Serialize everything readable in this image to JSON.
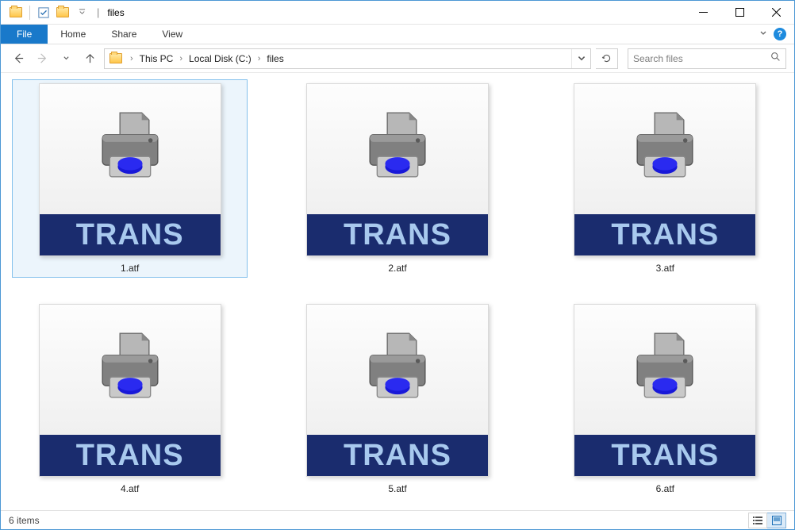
{
  "window": {
    "title": "files"
  },
  "tabs": {
    "file": "File",
    "home": "Home",
    "share": "Share",
    "view": "View"
  },
  "breadcrumbs": [
    "This PC",
    "Local Disk (C:)",
    "files"
  ],
  "search": {
    "placeholder": "Search files"
  },
  "files": [
    {
      "name": "1.atf",
      "badge": "TRANS",
      "selected": true
    },
    {
      "name": "2.atf",
      "badge": "TRANS",
      "selected": false
    },
    {
      "name": "3.atf",
      "badge": "TRANS",
      "selected": false
    },
    {
      "name": "4.atf",
      "badge": "TRANS",
      "selected": false
    },
    {
      "name": "5.atf",
      "badge": "TRANS",
      "selected": false
    },
    {
      "name": "6.atf",
      "badge": "TRANS",
      "selected": false
    }
  ],
  "status": {
    "count": "6 items"
  }
}
